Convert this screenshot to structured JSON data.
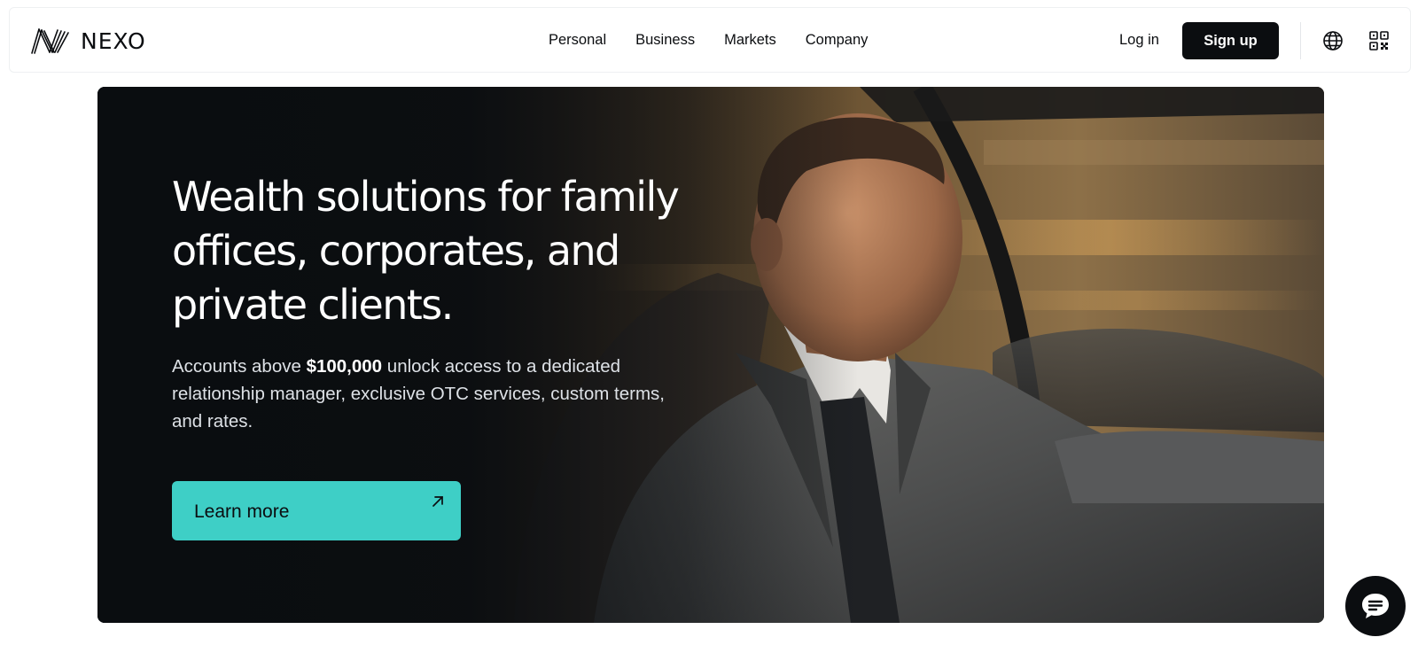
{
  "brand": {
    "name": "NEXO"
  },
  "nav": {
    "items": [
      {
        "label": "Personal"
      },
      {
        "label": "Business"
      },
      {
        "label": "Markets"
      },
      {
        "label": "Company"
      }
    ]
  },
  "header": {
    "login_label": "Log in",
    "signup_label": "Sign up",
    "icons": [
      "globe-icon",
      "qr-code-icon"
    ]
  },
  "hero": {
    "title": "Wealth solutions for family offices, corporates, and private clients.",
    "subtitle_prefix": "Accounts above ",
    "subtitle_highlight": "$100,000",
    "subtitle_suffix": " unlock access to a dedicated relationship manager, exclusive OTC services, custom terms, and rates.",
    "cta_label": "Learn more",
    "cta_icon": "arrow-up-right-icon"
  },
  "chat": {
    "icon": "chat-bubble-icon"
  },
  "colors": {
    "accent": "#3ecfc6",
    "dark": "#0b0d10",
    "white": "#ffffff"
  }
}
